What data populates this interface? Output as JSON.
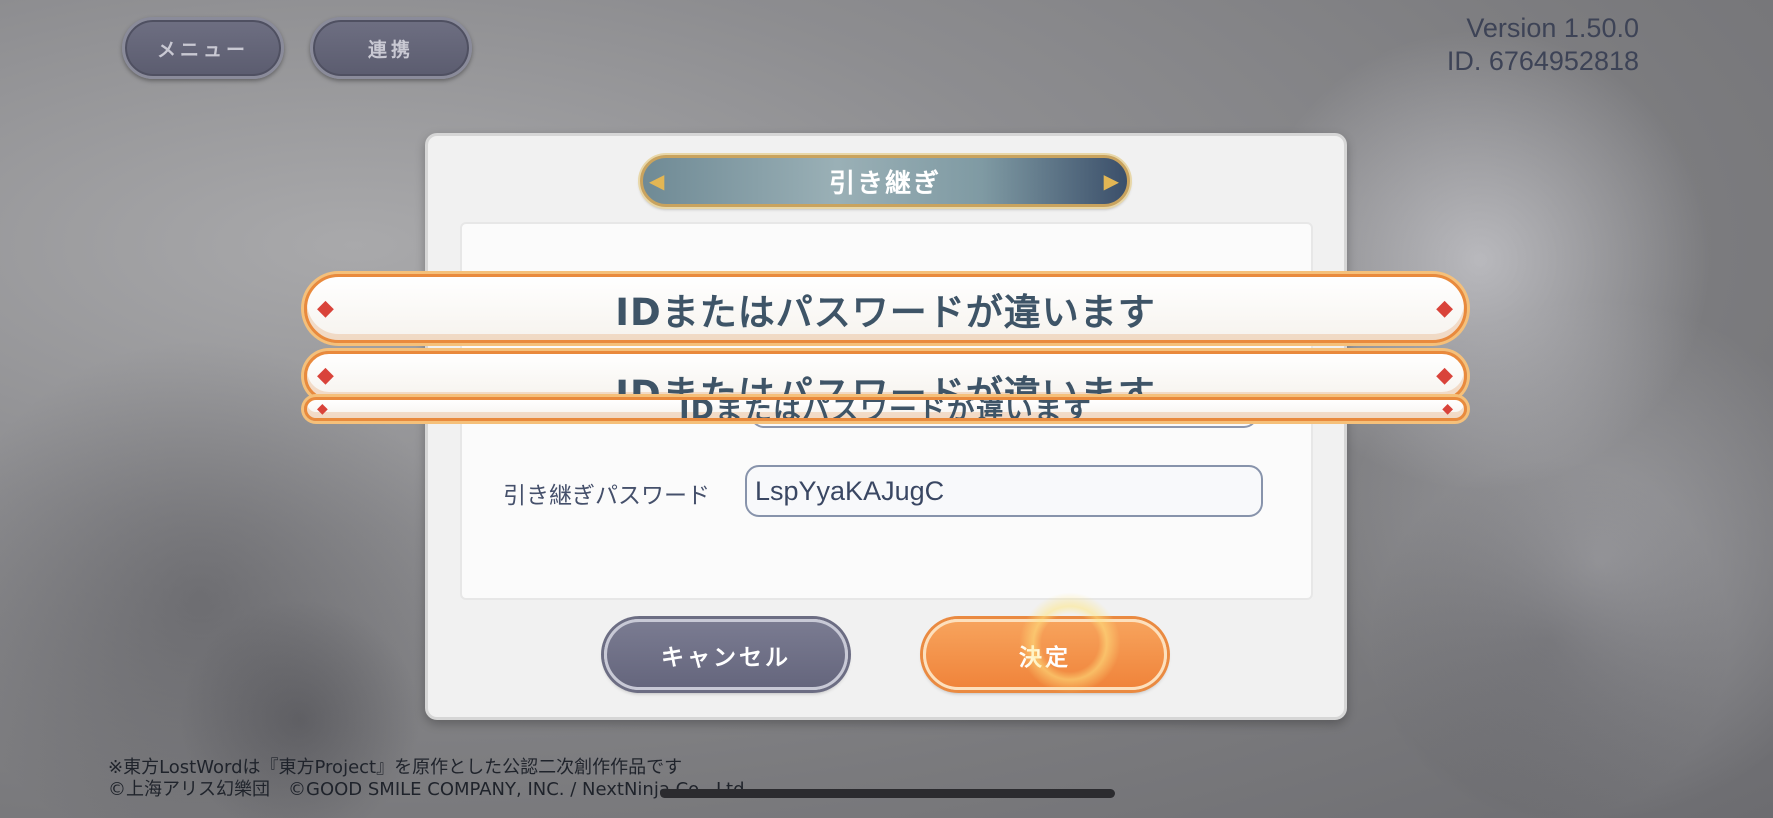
{
  "top_buttons": {
    "menu": "メニュー",
    "link": "連携"
  },
  "version_info": {
    "version": "Version 1.50.0",
    "id": "ID. 6764952818"
  },
  "dialog": {
    "title": "引き継ぎ",
    "password_label": "引き継ぎパスワード",
    "password_value": "LspYyaKAJugC",
    "cancel_label": "キャンセル",
    "ok_label": "決定"
  },
  "toasts": [
    "IDまたはパスワードが違います",
    "IDまたはパスワードが違います",
    "IDまたはパスワードが違います"
  ],
  "footer": {
    "line1": "※東方LostWordは『東方Project』を原作とした公認二次創作作品です",
    "line2": "©上海アリス幻樂団　©GOOD SMILE COMPANY, INC. / NextNinja Co., Ltd."
  },
  "colors": {
    "toast_border": "#e98a3d",
    "ok_button": "#f0843b",
    "cancel_button": "#65667d",
    "diamond": "#d9433a"
  }
}
